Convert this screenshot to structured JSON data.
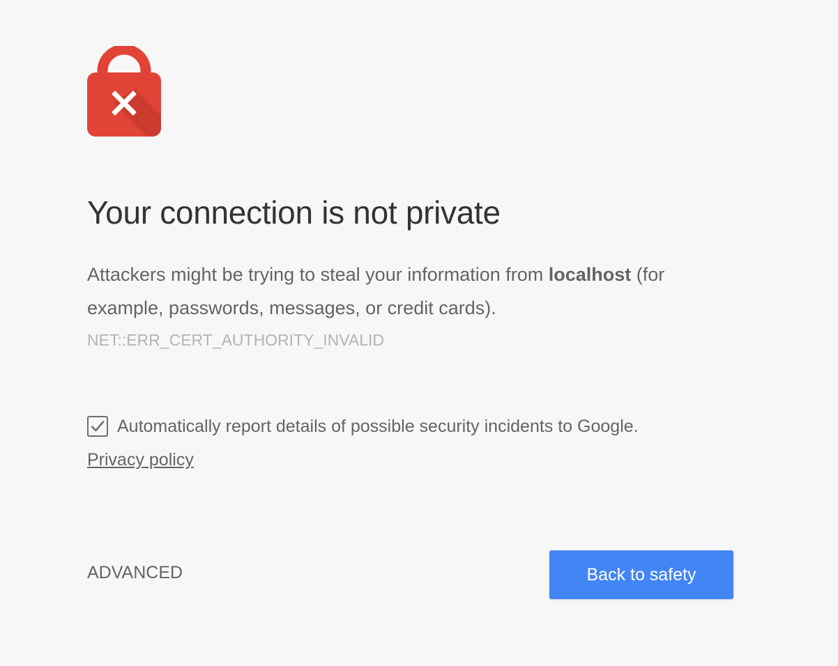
{
  "icon": "lock-error-icon",
  "heading": "Your connection is not private",
  "explanation": {
    "prefix": "Attackers might be trying to steal your information from ",
    "host": "localhost",
    "suffix": " (for example, passwords, messages, or credit cards)."
  },
  "error_code": "NET::ERR_CERT_AUTHORITY_INVALID",
  "report": {
    "checked": true,
    "label": "Automatically report details of possible security incidents to Google."
  },
  "privacy_link": "Privacy policy",
  "buttons": {
    "advanced": "ADVANCED",
    "primary": "Back to safety"
  },
  "colors": {
    "background": "#f7f7f7",
    "lock": "#e14336",
    "primary_button": "#4285f4"
  }
}
